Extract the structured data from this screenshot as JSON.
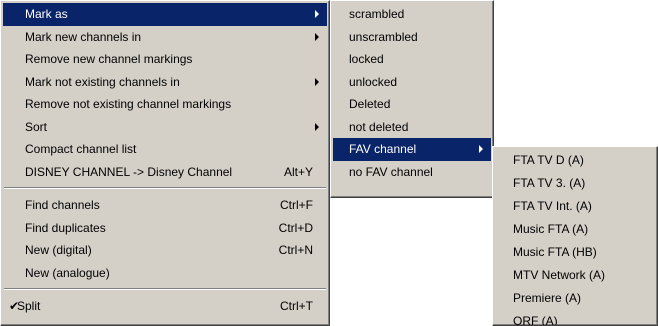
{
  "main_menu": {
    "group1": [
      {
        "label": "Mark as",
        "shortcut": "",
        "submenu": true,
        "highlighted": true
      },
      {
        "label": "Mark new channels in",
        "shortcut": "",
        "submenu": true
      },
      {
        "label": "Remove new channel markings",
        "shortcut": "",
        "submenu": false
      },
      {
        "label": "Mark not existing channels in",
        "shortcut": "",
        "submenu": true
      },
      {
        "label": "Remove not existing channel markings",
        "shortcut": "",
        "submenu": false
      },
      {
        "label": "Sort",
        "shortcut": "",
        "submenu": true
      },
      {
        "label": "Compact channel list",
        "shortcut": "",
        "submenu": false
      },
      {
        "label": "DISNEY CHANNEL -> Disney Channel",
        "shortcut": "Alt+Y",
        "submenu": false
      }
    ],
    "group2": [
      {
        "label": "Find channels",
        "shortcut": "Ctrl+F"
      },
      {
        "label": "Find duplicates",
        "shortcut": "Ctrl+D"
      },
      {
        "label": "New (digital)",
        "shortcut": "Ctrl+N"
      },
      {
        "label": "New (analogue)",
        "shortcut": ""
      }
    ],
    "group3": [
      {
        "label": "Split",
        "shortcut": "Ctrl+T",
        "checked": true,
        "check_glyph": "✔"
      }
    ]
  },
  "submenu_mark_as": [
    {
      "label": "scrambled"
    },
    {
      "label": "unscrambled"
    },
    {
      "label": "locked"
    },
    {
      "label": "unlocked"
    },
    {
      "label": "Deleted"
    },
    {
      "label": "not deleted"
    },
    {
      "label": "FAV channel",
      "submenu": true,
      "highlighted": true
    },
    {
      "label": "no FAV channel"
    }
  ],
  "submenu_fav": [
    {
      "label": "FTA TV D (A)"
    },
    {
      "label": "FTA TV 3. (A)"
    },
    {
      "label": "FTA TV Int. (A)"
    },
    {
      "label": "Music FTA (A)"
    },
    {
      "label": "Music FTA (HB)"
    },
    {
      "label": "MTV Network (A)"
    },
    {
      "label": "Premiere (A)"
    },
    {
      "label": "ORF (A)"
    }
  ],
  "colors": {
    "menu_bg": "#d4d0c8",
    "highlight_bg": "#0a246a",
    "highlight_text": "#ffffff"
  }
}
